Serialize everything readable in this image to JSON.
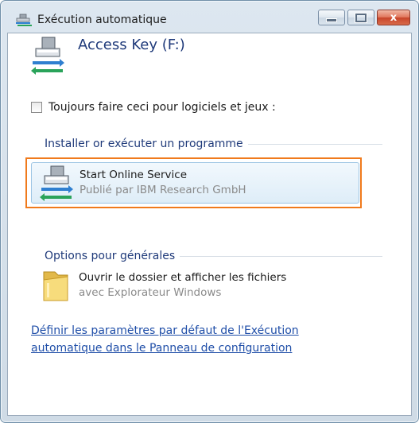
{
  "window": {
    "title": "Exécution automatique",
    "buttons": {
      "close": "x"
    }
  },
  "header": {
    "drive_name": "Access Key (F:)",
    "icon": "removable-drive-icon"
  },
  "checkbox": {
    "label": "Toujours faire ceci pour logiciels et jeux :",
    "checked": false
  },
  "sections": {
    "install": {
      "title": "Installer or exécuter un programme",
      "options": [
        {
          "title": "Start Online Service",
          "subtitle": "Publié par IBM Research GmbH",
          "icon": "removable-drive-icon",
          "highlighted": true
        }
      ]
    },
    "general": {
      "title": "Options pour générales",
      "options": [
        {
          "title": "Ouvrir le dossier et afficher les fichiers",
          "subtitle": "avec Explorateur Windows",
          "icon": "folder-icon"
        }
      ]
    }
  },
  "footer_link": "Définir les paramètres par défaut de l'Exécution automatique dans le Panneau de configuration",
  "colors": {
    "highlight_border": "#f07a1c",
    "link": "#1f4ea8",
    "section_title": "#1f3a7a"
  }
}
